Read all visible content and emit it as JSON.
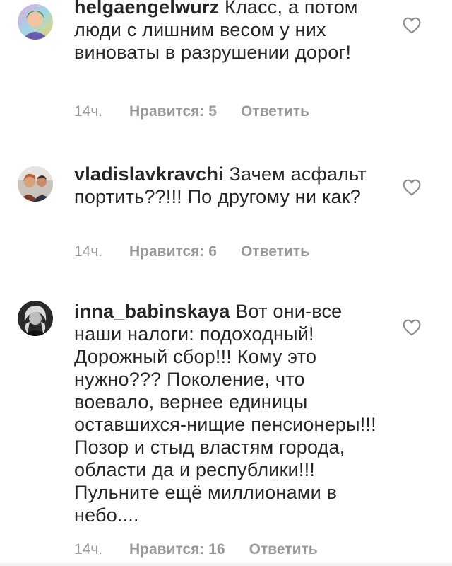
{
  "comments": [
    {
      "username": "helgaengelwurz",
      "text": "Класс, а потом люди с лишним весом у них виноваты в разрушении дорог!",
      "time": "14ч.",
      "likes": "Нравится: 5",
      "reply": "Ответить",
      "avatar_icon": "avatar-colorful-portrait"
    },
    {
      "username": "vladislavkravchi",
      "text": "Зачем асфальт портить??!!! По другому ни как?",
      "time": "14ч.",
      "likes": "Нравится: 6",
      "reply": "Ответить",
      "avatar_icon": "avatar-couple-photo"
    },
    {
      "username": "inna_babinskaya",
      "text": "Вот они-все наши налоги: подоходный! Дорожный сбор!!! Кому это нужно??? Поколение, что воевало, вернее единицы оставшихся-нищие пенсионеры!!! Позор и стыд властям города, области да и республики!!! Пульните ещё миллионами в небо....",
      "time": "14ч.",
      "likes": "Нравится: 16",
      "reply": "Ответить",
      "avatar_icon": "avatar-bw-portrait"
    }
  ],
  "colors": {
    "text": "#262626",
    "meta": "#999999",
    "heart_stroke": "#8e8e8e"
  }
}
